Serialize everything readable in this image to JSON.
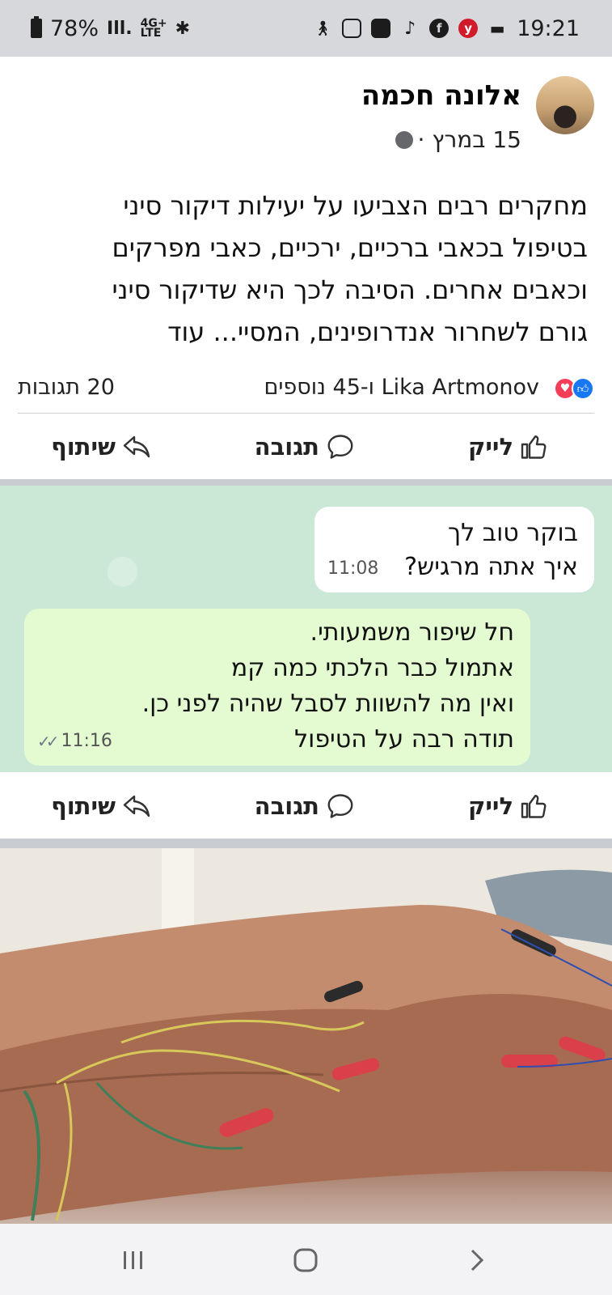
{
  "status_bar": {
    "battery": "78%",
    "network": "4G+ LTE",
    "time": "19:21"
  },
  "post1": {
    "author": "אלונה חכמה",
    "date": "15 במרץ ·",
    "text_lines": [
      "מחקרים רבים הצביעו על יעילות דיקור סיני",
      "בטיפול בכאבי ברכיים, ירכיים, כאבי מפרקים",
      "וכאבים אחרים. הסיבה לכך היא שדיקור סיני",
      "גורם לשחרור אנדרופינים, המסיי... עוד"
    ],
    "reactions_text": "Lika Artmonov ו-45 נוספים",
    "comments_count": "20 תגובות"
  },
  "actions": {
    "like": "לייק",
    "comment": "תגובה",
    "share": "שיתוף"
  },
  "chat": {
    "incoming": {
      "lines": [
        "בוקר טוב לך",
        "איך אתה מרגיש?"
      ],
      "time": "11:08"
    },
    "outgoing": {
      "lines": [
        "חל שיפור משמעותי.",
        "אתמול כבר הלכתי כמה קמ",
        "ואין מה להשוות לסבל שהיה לפני כן.",
        "תודה רבה על הטיפול"
      ],
      "time": "11:16"
    }
  },
  "icons": {
    "like": "thumbs-up-icon",
    "comment": "speech-bubble-icon",
    "share": "share-arrow-icon",
    "globe": "globe-icon"
  },
  "colors": {
    "facebook_blue": "#1877f2",
    "love_red": "#f33e58",
    "chat_bg": "#cbe8d7",
    "outgoing_bubble": "#e4fbd2"
  }
}
